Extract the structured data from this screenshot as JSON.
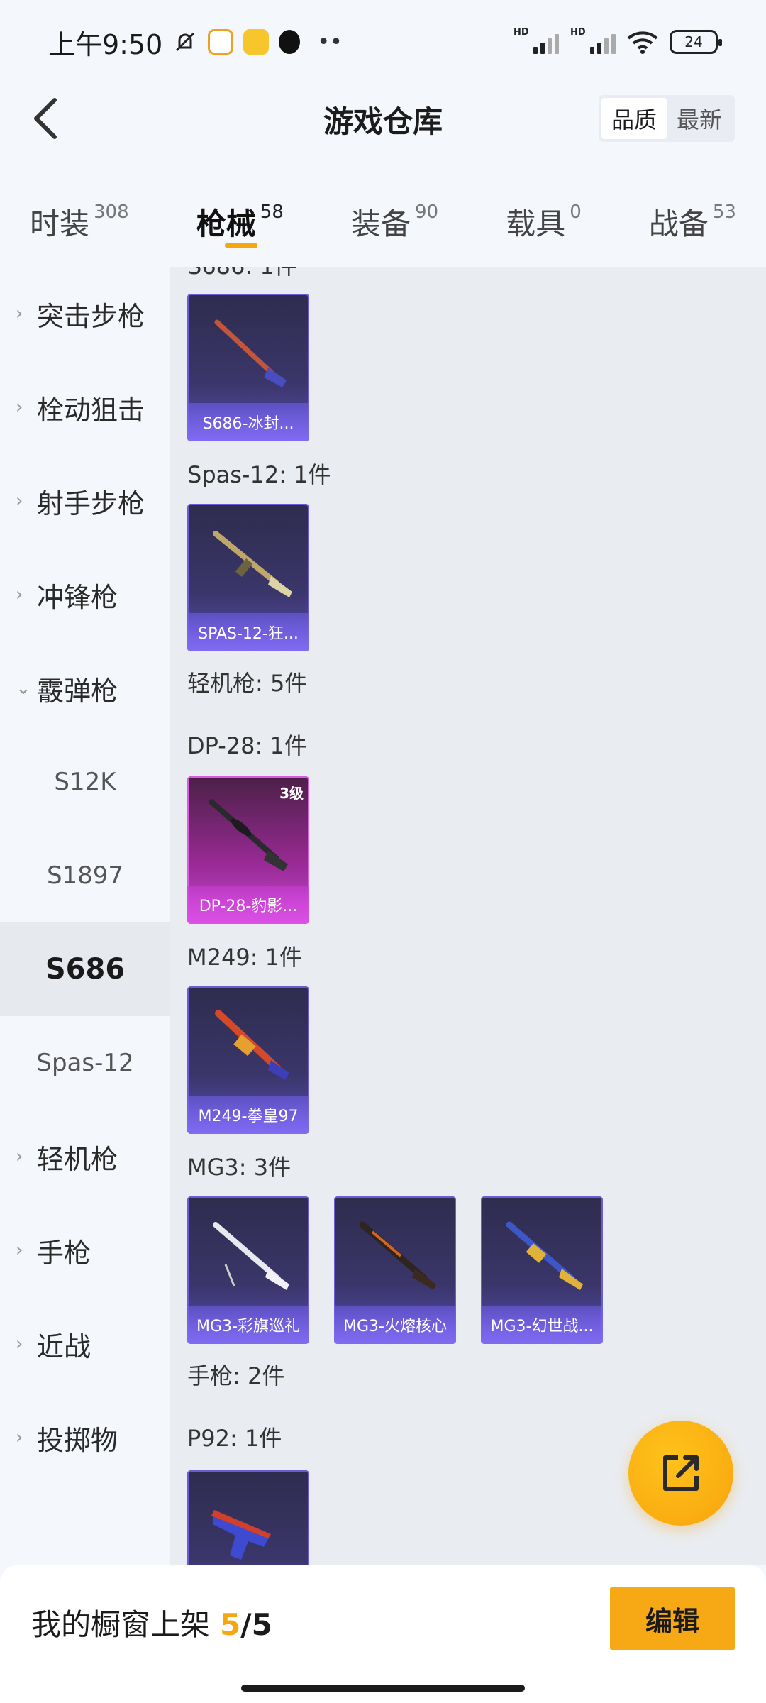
{
  "status": {
    "time": "上午9:50",
    "battery": "24"
  },
  "header": {
    "title": "游戏仓库",
    "sort_options": [
      "品质",
      "最新"
    ]
  },
  "tabs": [
    {
      "label": "时装",
      "count": "308"
    },
    {
      "label": "枪械",
      "count": "58"
    },
    {
      "label": "装备",
      "count": "90"
    },
    {
      "label": "载具",
      "count": "0"
    },
    {
      "label": "战备",
      "count": "53"
    }
  ],
  "sidebar": {
    "categories": [
      "突击步枪",
      "栓动狙击",
      "射手步枪",
      "冲锋枪",
      "霰弹枪"
    ],
    "shotgun_subs": [
      "S12K",
      "S1897",
      "S686",
      "Spas-12"
    ],
    "more_categories": [
      "轻机枪",
      "手枪",
      "近战",
      "投掷物"
    ]
  },
  "content": {
    "top_partial": "S686: 1件",
    "items": [
      {
        "header": "Spas-12: 1件"
      },
      {
        "header": "轻机枪: 5件"
      },
      {
        "header": "DP-28: 1件"
      },
      {
        "header": "M249: 1件"
      },
      {
        "header": "MG3: 3件"
      },
      {
        "header": "手枪: 2件"
      },
      {
        "header": "P92: 1件"
      }
    ],
    "cards": {
      "s686": "S686-冰封...",
      "spas": "SPAS-12-狂...",
      "dp28": "DP-28-豹影...",
      "dp28_badge": "3级",
      "m249": "M249-拳皇97",
      "mg3_1": "MG3-彩旗巡礼",
      "mg3_2": "MG3-火熔核心",
      "mg3_3": "MG3-幻世战..."
    }
  },
  "bottom": {
    "showcase_label": "我的橱窗上架",
    "current": "5",
    "total": "/5",
    "edit_label": "编辑"
  }
}
